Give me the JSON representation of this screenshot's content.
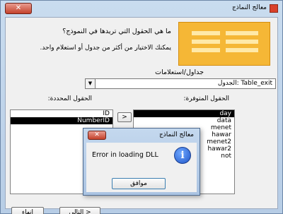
{
  "wizard": {
    "title": "معالج النماذج",
    "close_glyph": "✕",
    "question": "ما هي الحقول التي تريدها في النموذج؟",
    "hint": "يمكنك الاختيار من أكثر من جدول أو استعلام واحد.",
    "tables_label": "جداول/استعلامات",
    "table_combo_value": "الجدول: Table_exit",
    "available_label": "الحقول المتوفرة:",
    "selected_label": "الحقول المحددة:",
    "available_fields": [
      "day",
      "data",
      "menet",
      "hawar",
      "menet2",
      "hawar2",
      "not"
    ],
    "available_selected_index": 0,
    "selected_fields": [
      "ID",
      "NumberID"
    ],
    "selected_selected_index": 1,
    "add_button": ">",
    "next_button": "التالي >",
    "finish_button": "إنهاء"
  },
  "error_dialog": {
    "title": "معالج النماذج",
    "close_glyph": "✕",
    "message": "Error in loading DLL",
    "icon": "info-icon",
    "ok_label": "موافق"
  },
  "colors": {
    "title_bar": "#b7cde6",
    "selection": "#000000",
    "close_button": "#c4412b",
    "graphic": "#f5b736"
  }
}
